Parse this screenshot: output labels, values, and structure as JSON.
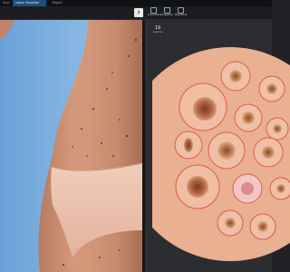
{
  "tabs": [
    {
      "label": "Scan"
    },
    {
      "label": "Lesion Visualizer"
    },
    {
      "label": "Report"
    }
  ],
  "toolbar": {
    "next_icon": "chevron-right-icon",
    "buttons": [
      {
        "label": "Zoom Mode",
        "icon": "zoom-icon"
      },
      {
        "label": "Snapshot",
        "icon": "snapshot-icon"
      },
      {
        "label": "Map Mode",
        "icon": "map-icon"
      }
    ]
  },
  "counter": {
    "value": "19",
    "unit": "Lesions"
  },
  "colors": {
    "tab_active": "#1f4e79",
    "lesion_outline": "#e05a4a",
    "skin": "#e9b092",
    "background": "#202225"
  }
}
